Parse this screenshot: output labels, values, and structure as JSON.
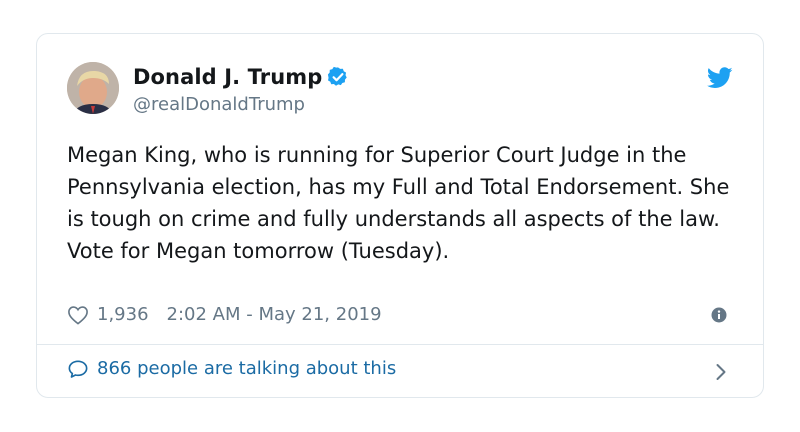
{
  "tweet": {
    "author_name": "Donald J. Trump",
    "author_handle": "@realDonaldTrump",
    "text": "Megan King, who is running for Superior Court Judge in the Pennsylvania election, has my Full and Total Endorsement. She is tough on crime and fully understands all aspects of the law. Vote for Megan tomorrow (Tuesday).",
    "likes": "1,936",
    "timestamp": "2:02 AM - May 21, 2019",
    "talking_text": "866 people are talking about this"
  },
  "icons": {
    "verified": "verified-badge-icon",
    "bird": "twitter-bird-icon",
    "heart": "heart-icon",
    "info": "info-icon",
    "talk": "speech-bubble-icon",
    "chevron": "chevron-right-icon"
  },
  "colors": {
    "accent": "#1da1f2",
    "link": "#1b6ba4",
    "secondary_text": "#657786",
    "border": "#e1e8ed"
  }
}
